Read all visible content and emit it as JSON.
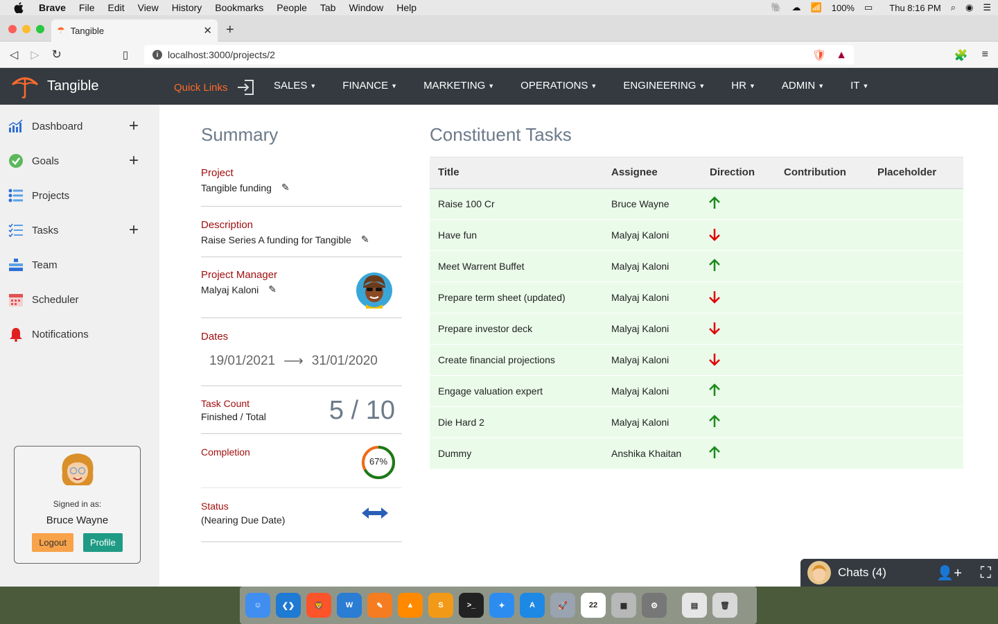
{
  "mac_menubar": {
    "app": "Brave",
    "items": [
      "File",
      "Edit",
      "View",
      "History",
      "Bookmarks",
      "People",
      "Tab",
      "Window",
      "Help"
    ],
    "battery": "100%",
    "clock": "Thu 8:16 PM"
  },
  "browser": {
    "tab_title": "Tangible",
    "url": "localhost:3000/projects/2"
  },
  "app_nav": {
    "brand": "Tangible",
    "quick_links": "Quick Links",
    "items": [
      "SALES",
      "FINANCE",
      "MARKETING",
      "OPERATIONS",
      "ENGINEERING",
      "HR",
      "ADMIN",
      "IT"
    ]
  },
  "sidebar": {
    "items": [
      {
        "label": "Dashboard",
        "icon": "chart-icon",
        "plus": true
      },
      {
        "label": "Goals",
        "icon": "check-circle-icon",
        "plus": true
      },
      {
        "label": "Projects",
        "icon": "list-icon",
        "plus": false
      },
      {
        "label": "Tasks",
        "icon": "checklist-icon",
        "plus": true
      },
      {
        "label": "Team",
        "icon": "org-chart-icon",
        "plus": false
      },
      {
        "label": "Scheduler",
        "icon": "calendar-icon",
        "plus": false
      },
      {
        "label": "Notifications",
        "icon": "bell-icon",
        "plus": false
      }
    ],
    "user": {
      "signed_in_label": "Signed in as:",
      "name": "Bruce Wayne",
      "logout": "Logout",
      "profile": "Profile"
    }
  },
  "summary": {
    "title": "Summary",
    "project_label": "Project",
    "project_value": "Tangible funding",
    "description_label": "Description",
    "description_value": "Raise Series A funding for Tangible",
    "manager_label": "Project Manager",
    "manager_value": "Malyaj Kaloni",
    "dates_label": "Dates",
    "date_start": "19/01/2021",
    "date_end": "31/01/2020",
    "task_count_label": "Task Count",
    "task_count_sub": "Finished / Total",
    "task_count_value": "5 / 10",
    "completion_label": "Completion",
    "completion_value": "67%",
    "completion_fraction": 0.67,
    "status_label": "Status",
    "status_value": "(Nearing Due Date)"
  },
  "tasks": {
    "title": "Constituent Tasks",
    "columns": [
      "Title",
      "Assignee",
      "Direction",
      "Contribution",
      "Placeholder"
    ],
    "rows": [
      {
        "title": "Raise 100 Cr",
        "assignee": "Bruce Wayne",
        "direction": "up"
      },
      {
        "title": "Have fun",
        "assignee": "Malyaj Kaloni",
        "direction": "down"
      },
      {
        "title": "Meet Warrent Buffet",
        "assignee": "Malyaj Kaloni",
        "direction": "up"
      },
      {
        "title": "Prepare term sheet (updated)",
        "assignee": "Malyaj Kaloni",
        "direction": "down"
      },
      {
        "title": "Prepare investor deck",
        "assignee": "Malyaj Kaloni",
        "direction": "down"
      },
      {
        "title": "Create financial projections",
        "assignee": "Malyaj Kaloni",
        "direction": "down"
      },
      {
        "title": "Engage valuation expert",
        "assignee": "Malyaj Kaloni",
        "direction": "up"
      },
      {
        "title": "Die Hard 2",
        "assignee": "Malyaj Kaloni",
        "direction": "up"
      },
      {
        "title": "Dummy",
        "assignee": "Anshika Khaitan",
        "direction": "up"
      }
    ]
  },
  "chats": {
    "label": "Chats (4)"
  },
  "colors": {
    "accent": "#ff6a2b",
    "nav": "#343a40",
    "up": "#1a8a1a",
    "down": "#e00000",
    "label_red": "#a00f0f"
  }
}
